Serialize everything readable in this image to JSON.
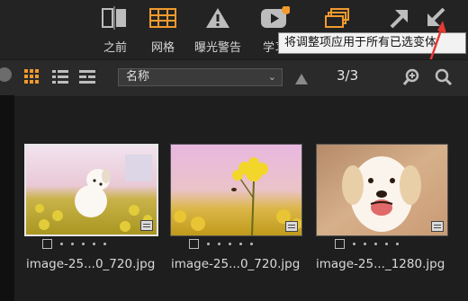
{
  "toolbar": {
    "items": [
      {
        "label": "之前",
        "icon": "split-compare-icon"
      },
      {
        "label": "网格",
        "icon": "grid-icon"
      },
      {
        "label": "曝光警告",
        "icon": "warning-icon"
      },
      {
        "label": "学习",
        "icon": "play-icon"
      },
      {
        "label": "",
        "icon": "stack-icon"
      },
      {
        "label": "",
        "icon": "arrow-up-right-icon"
      },
      {
        "label": "",
        "icon": "arrow-down-left-icon"
      }
    ],
    "tooltip": "将调整项应用于所有已选变体"
  },
  "subbar": {
    "sort_select": "名称",
    "pager": "3/3"
  },
  "thumbnails": [
    {
      "filename": "image-25...0_720.jpg",
      "selected": true
    },
    {
      "filename": "image-25...0_720.jpg",
      "selected": false
    },
    {
      "filename": "image-25..._1280.jpg",
      "selected": false
    }
  ],
  "colors": {
    "accent": "#f29a2e",
    "background": "#1e1e1e",
    "annotation_arrow": "#e53935"
  }
}
